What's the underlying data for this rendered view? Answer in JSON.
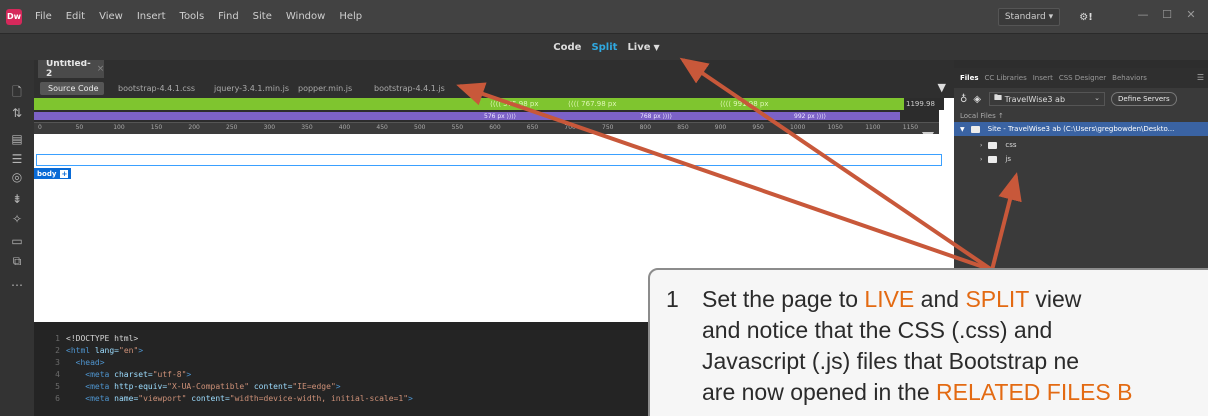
{
  "menubar": {
    "logo": "Dw",
    "items": [
      "File",
      "Edit",
      "View",
      "Insert",
      "Tools",
      "Find",
      "Site",
      "Window",
      "Help"
    ],
    "workspace": "Standard",
    "sync_icon": "sync-icon"
  },
  "viewbar": {
    "code": "Code",
    "split": "Split",
    "live": "Live"
  },
  "document": {
    "tab_title": "Untitled-2",
    "related_files": [
      "Source Code",
      "bootstrap-4.4.1.css",
      "jquery-3.4.1.min.js",
      "popper.min.js",
      "bootstrap-4.4.1.js"
    ],
    "mq_green": [
      "575.98 px",
      "767.98 px",
      "991.98 px",
      "1199.98"
    ],
    "mq_purple": [
      "576 px",
      "768 px",
      "992 px"
    ],
    "ruler_ticks": [
      "0",
      "50",
      "100",
      "150",
      "200",
      "250",
      "300",
      "350",
      "400",
      "450",
      "500",
      "550",
      "600",
      "650",
      "700",
      "750",
      "800",
      "850",
      "900",
      "950",
      "1000",
      "1050",
      "1100",
      "1150"
    ],
    "body_badge": "body",
    "code_lines": [
      {
        "n": "1",
        "parts": [
          [
            "txt",
            "<!DOCTYPE html>"
          ]
        ]
      },
      {
        "n": "2",
        "parts": [
          [
            "tag",
            "<html "
          ],
          [
            "attr",
            "lang="
          ],
          [
            "val",
            "\"en\""
          ],
          [
            "tag",
            ">"
          ]
        ]
      },
      {
        "n": "3",
        "parts": [
          [
            "tag",
            "  <head>"
          ]
        ]
      },
      {
        "n": "4",
        "parts": [
          [
            "tag",
            "    <meta "
          ],
          [
            "attr",
            "charset="
          ],
          [
            "val",
            "\"utf-8\""
          ],
          [
            "tag",
            ">"
          ]
        ]
      },
      {
        "n": "5",
        "parts": [
          [
            "tag",
            "    <meta "
          ],
          [
            "attr",
            "http-equiv="
          ],
          [
            "val",
            "\"X-UA-Compatible\""
          ],
          [
            "attr",
            " content="
          ],
          [
            "val",
            "\"IE=edge\""
          ],
          [
            "tag",
            ">"
          ]
        ]
      },
      {
        "n": "6",
        "parts": [
          [
            "tag",
            "    <meta "
          ],
          [
            "attr",
            "name="
          ],
          [
            "val",
            "\"viewport\""
          ],
          [
            "attr",
            " content="
          ],
          [
            "val",
            "\"width=device-width, initial-scale=1\""
          ],
          [
            "tag",
            ">"
          ]
        ]
      }
    ]
  },
  "files_panel": {
    "tabs": [
      "Files",
      "CC Libraries",
      "Insert",
      "CSS Designer",
      "Behaviors"
    ],
    "site": "TravelWise3 ab",
    "define_servers": "Define Servers",
    "local_files": "Local Files",
    "root": "Site - TravelWise3 ab (C:\\Users\\gregbowden\\Deskto...",
    "folders": [
      "css",
      "js"
    ]
  },
  "callout": {
    "number": "1",
    "line1_a": "Set the page to ",
    "line1_live": "LIVE",
    "line1_b": " and ",
    "line1_split": "SPLIT",
    "line1_c": " view",
    "line2": "and notice that the CSS (.css) and",
    "line3": "Javascript (.js) files that Bootstrap ne",
    "line4_a": "are now opened in the ",
    "line4_hl": "RELATED FILES B"
  },
  "colors": {
    "accent": "#2fa8e0",
    "callout_highlight": "#e36a12",
    "arrow": "#c8583a"
  }
}
